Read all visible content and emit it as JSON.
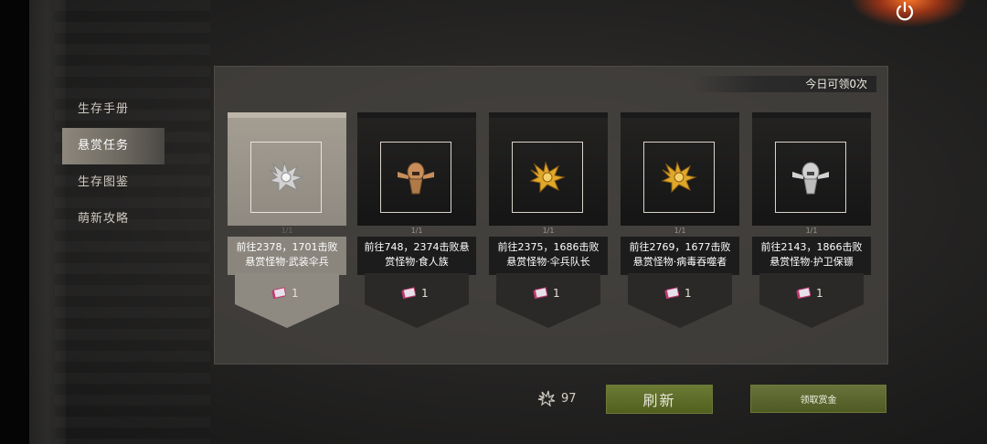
{
  "sidebar": {
    "items": [
      {
        "label": "生存手册",
        "active": false
      },
      {
        "label": "悬赏任务",
        "active": true
      },
      {
        "label": "生存图鉴",
        "active": false
      },
      {
        "label": "萌新攻略",
        "active": false
      }
    ]
  },
  "panel": {
    "daily_claims_text": "今日可领0次",
    "cards": [
      {
        "progress": "1/1",
        "desc_line1": "前往2378，1701击败",
        "desc_line2": "悬赏怪物·武装伞兵",
        "reward_count": "1",
        "monster_color": "silver",
        "monster_icon": "winged-beast-icon",
        "selected": true
      },
      {
        "progress": "1/1",
        "desc_line1": "前往748，2374击败悬",
        "desc_line2": "赏怪物·食人族",
        "reward_count": "1",
        "monster_color": "bronze",
        "monster_icon": "cannibal-icon",
        "selected": false
      },
      {
        "progress": "1/1",
        "desc_line1": "前往2375，1686击败",
        "desc_line2": "悬赏怪物·伞兵队长",
        "reward_count": "1",
        "monster_color": "gold",
        "monster_icon": "winged-beast-icon",
        "selected": false
      },
      {
        "progress": "1/1",
        "desc_line1": "前往2769，1677击败",
        "desc_line2": "悬赏怪物·病毒吞噬者",
        "reward_count": "1",
        "monster_color": "gold",
        "monster_icon": "winged-beast-icon",
        "selected": false
      },
      {
        "progress": "1/1",
        "desc_line1": "前往2143，1866击败",
        "desc_line2": "悬赏怪物·护卫保镖",
        "reward_count": "1",
        "monster_color": "silver",
        "monster_icon": "cannibal-icon",
        "selected": false
      }
    ]
  },
  "footer": {
    "coin_count": "97",
    "refresh_label": "刷新",
    "claim_label": "领取赏金"
  },
  "colors": {
    "silver": "#d2d2d2",
    "gold": "#e0a82a",
    "bronze": "#c88e5a",
    "accent_green": "#5d6b28"
  }
}
